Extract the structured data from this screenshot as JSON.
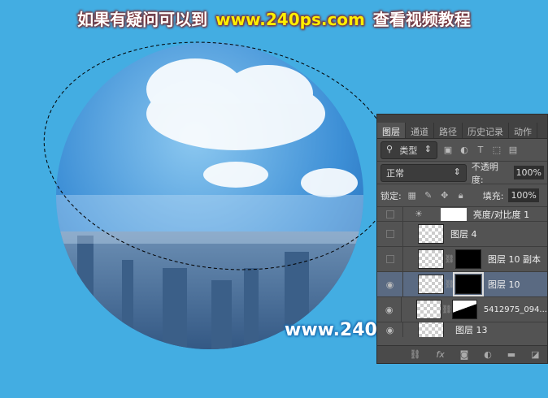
{
  "banner": {
    "left": "如果有疑问可以到",
    "url": "www.240ps.com",
    "right": "查看视频教程"
  },
  "watermark": "www.240ps.com",
  "panel": {
    "tabs": [
      "图层",
      "通道",
      "路径",
      "历史记录",
      "动作"
    ],
    "filter": "类型",
    "blend_mode": "正常",
    "opacity_label": "不透明度:",
    "opacity": "100%",
    "lock_label": "锁定:",
    "fill_label": "填充:",
    "fill": "100%",
    "layers": [
      {
        "name": "亮度/对比度 1",
        "visible": false
      },
      {
        "name": "图层 4",
        "visible": false
      },
      {
        "name": "图层 10 副本",
        "visible": false
      },
      {
        "name": "图层 10",
        "visible": true,
        "active": true
      },
      {
        "name": "5412975_094...",
        "visible": true
      },
      {
        "name": "图层 13",
        "visible": true
      }
    ]
  }
}
